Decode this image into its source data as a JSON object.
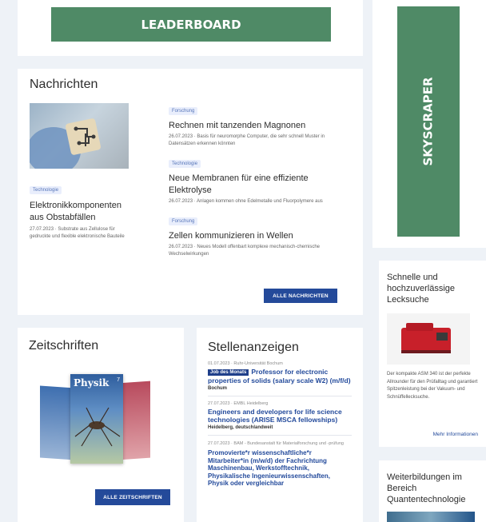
{
  "ads": {
    "leaderboard": "LEADERBOARD",
    "skyscraper": "SKYSCRAPER",
    "colors": {
      "ad_green": "#4f8a66"
    }
  },
  "news": {
    "title": "Nachrichten",
    "featured": {
      "tag": "Technologie",
      "headline": "Elektronikkomponenten aus Obstabfällen",
      "meta": "27.07.2023 · Substrate aus Zellulose für gedruckte und flexible elektronische Bauteile"
    },
    "items": [
      {
        "tag": "Forschung",
        "headline": "Rechnen mit tanzenden Magnonen",
        "meta": "26.07.2023 · Basis für neuromorphe Computer, die sehr schnell Muster in Datensätzen erkennen könnten"
      },
      {
        "tag": "Technologie",
        "headline": "Neue Membranen für eine effiziente Elektrolyse",
        "meta": "26.07.2023 · Anlagen kommen ohne Edelmetalle und Fluorpolymere aus"
      },
      {
        "tag": "Forschung",
        "headline": "Zellen kommunizieren in Wellen",
        "meta": "26.07.2023 · Neues Modell offenbart komplexe mechanisch-chemische Wechselwirkungen"
      }
    ],
    "button": "ALLE NACHRICHTEN"
  },
  "journals": {
    "title": "Zeitschriften",
    "cover_title": "Physik",
    "cover_number": "7",
    "button": "ALLE ZEITSCHRIFTEN"
  },
  "jobs": {
    "title": "Stellenanzeigen",
    "items": [
      {
        "meta": "01.07.2023 · Ruhr-Universität Bochum",
        "badge": "Job des Monats",
        "title": "Professor for electronic properties of solids (salary scale W2) (m/f/d)",
        "location": "Bochum"
      },
      {
        "meta": "27.07.2023 · EMBL Heidelberg",
        "badge": "",
        "title": "Engineers and developers for life science technologies (ARISE MSCA fellowships)",
        "location": "Heidelberg, deutschlandweit"
      },
      {
        "meta": "27.07.2023 · BAM - Bundesanstalt für Materialforschung und -prüfung",
        "badge": "",
        "title": "Promovierte*r wissenschaftliche*r Mitarbeiter*in (m/w/d) der Fachrichtung Maschinenbau, Werkstofftechnik, Physikalische Ingenieurwissenschaften, Physik oder vergleichbar",
        "location": ""
      }
    ]
  },
  "sidebar": {
    "promo1": {
      "title": "Schnelle und hochzuverlässige Lecksuche",
      "text": "Der kompakte ASM 340 ist der perfekte Allrounder für den Prüfalltag und garantiert Spitzenleistung bei der Vakuum- und Schnüffellecksuche.",
      "link": "Mehr Informationen"
    },
    "promo2": {
      "title": "Weiterbildungen im Bereich Quantentechnologie"
    }
  }
}
